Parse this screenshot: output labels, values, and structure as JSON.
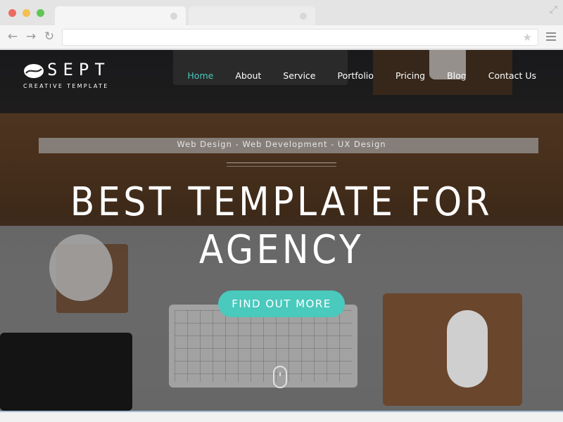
{
  "browser": {
    "traffic_lights": [
      "#ec6b5f",
      "#f4bf4f",
      "#61c554"
    ],
    "icons": [
      "back-arrow-icon",
      "forward-arrow-icon",
      "reload-icon",
      "star-icon",
      "hamburger-menu-icon",
      "expand-icon"
    ],
    "back_glyph": "←",
    "forward_glyph": "→",
    "reload_glyph": "↻",
    "star_glyph": "★",
    "expand_glyph": "⤢"
  },
  "site": {
    "logo": {
      "name": "SEPT",
      "subtitle": "CREATIVE TEMPLATE"
    },
    "nav": [
      {
        "label": "Home",
        "active": true
      },
      {
        "label": "About",
        "active": false
      },
      {
        "label": "Service",
        "active": false
      },
      {
        "label": "Portfolio",
        "active": false
      },
      {
        "label": "Pricing",
        "active": false
      },
      {
        "label": "Blog",
        "active": false
      },
      {
        "label": "Contact Us",
        "active": false
      }
    ],
    "hero": {
      "tagline": "Web Design - Web Development - UX Design",
      "headline_line1": "BEST TEMPLATE FOR",
      "headline_line2": "AGENCY",
      "cta": "FIND OUT MORE"
    },
    "colors": {
      "accent": "#4ac9bd",
      "text": "#ffffff"
    }
  }
}
